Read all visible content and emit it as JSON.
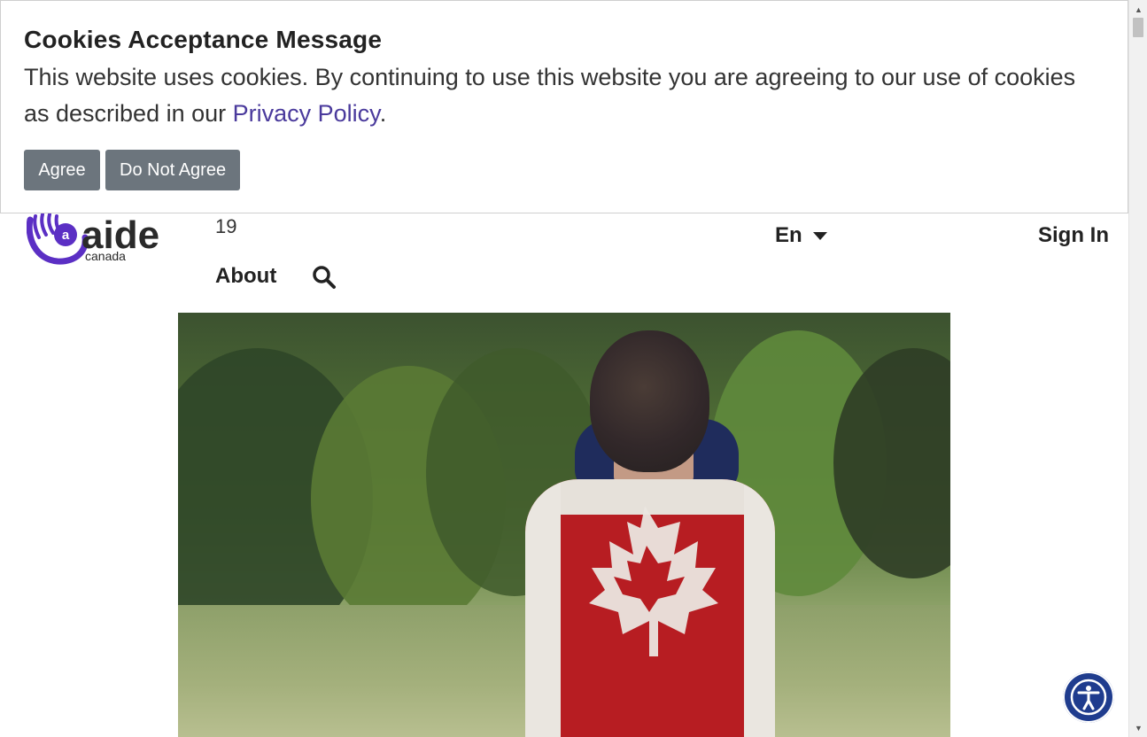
{
  "cookie_banner": {
    "title": "Cookies Acceptance Message",
    "text_before_link": "This website uses cookies. By continuing to use this website you are agreeing to our use of cookies as described in our ",
    "link_text": "Privacy Policy",
    "text_after_link": ".",
    "agree_label": "Agree",
    "disagree_label": "Do Not Agree"
  },
  "header": {
    "logo_alt": "aide canada",
    "logo_main": "aide",
    "logo_sub": "canada",
    "logo_letter": "a",
    "nav_number": "19",
    "about_label": "About",
    "search_icon": "search-icon",
    "language_label": "En",
    "sign_in_label": "Sign In"
  },
  "hero": {
    "image_alt": "child wrapped in Canadian flag"
  },
  "accessibility": {
    "icon": "accessibility-icon"
  },
  "colors": {
    "brand_purple": "#5b2fc4",
    "button_gray": "#6c757d",
    "link_purple": "#4a3a9c",
    "accessibility_blue": "#1f3c8e"
  }
}
